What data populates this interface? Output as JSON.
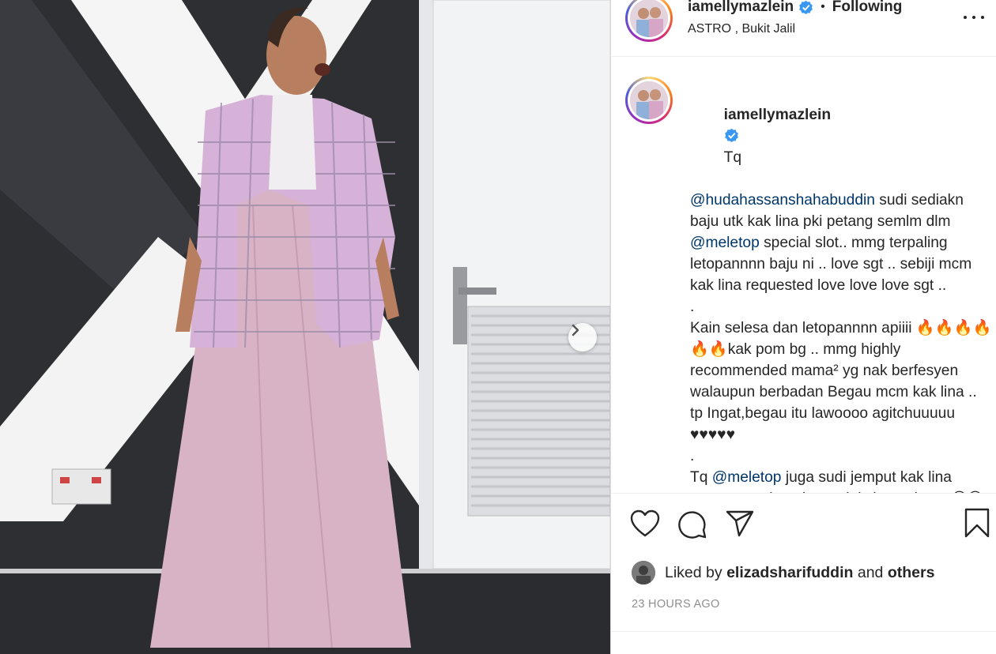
{
  "post": {
    "username": "iamellymazlein",
    "follow_status": "Following",
    "separator": "•",
    "location": "ASTRO , Bukit Jalil"
  },
  "caption": {
    "username": "iamellymazlein",
    "lines": [
      {
        "pre": "Tq",
        "mention": "",
        "post": ""
      },
      {
        "pre": "",
        "mention": "@hudahassanshahabuddin",
        "post": " sudi sediakn baju utk kak lina pki petang semlm dlm "
      },
      {
        "pre": "",
        "mention": "@meletop",
        "post": " special slot.. mmg terpaling letopannnn baju ni .. love sgt .. sebiji mcm kak lina requested love love love sgt .."
      },
      {
        "pre": ".",
        "mention": "",
        "post": ""
      },
      {
        "pre": "Kain selesa dan letopannnn apiiii 🔥🔥🔥🔥🔥🔥kak pom bg .. mmg highly recommended mama² yg nak berfesyen walaupun berbadan Begau mcm kak lina .. tp Ingat,begau itu lawoooo agitchuuuuu ♥♥♥♥♥",
        "mention": "",
        "post": ""
      },
      {
        "pre": ".",
        "mention": "",
        "post": ""
      },
      {
        "pre": "Tq ",
        "mention": "@meletop",
        "post": " juga sudi jemput kak lina petang semlm utk special slot meletop 😋😋😋 ada rezki InsyaAllah kite jmpa Tahun depan .."
      }
    ]
  },
  "likes": {
    "prefix": "Liked by",
    "liker": "elizadsharifuddin",
    "joiner": "and",
    "others": "others"
  },
  "timestamp": "23 HOURS AGO",
  "icons": {
    "like": "heart-icon",
    "comment": "comment-icon",
    "share": "paper-plane-icon",
    "save": "bookmark-icon",
    "more": "more-options-icon",
    "next": "chevron-right-icon",
    "verified": "verified-badge-icon"
  },
  "colors": {
    "mention": "#00376b",
    "verified": "#3897f0",
    "timestamp": "#8e8e8e"
  }
}
